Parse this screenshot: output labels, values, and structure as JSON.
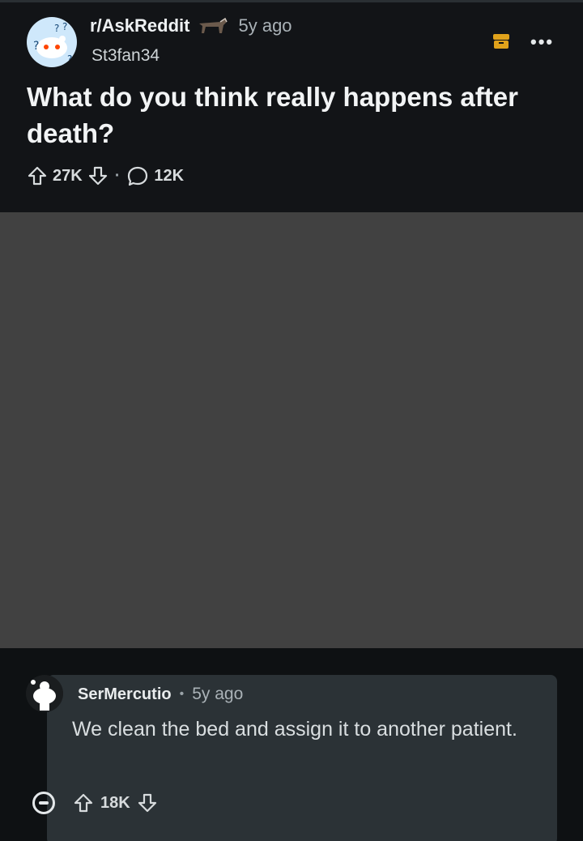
{
  "post": {
    "subreddit": "r/AskReddit",
    "time": "5y ago",
    "author": "St3fan34",
    "title": "What do you think really happens after death?",
    "upvotes": "27K",
    "separator": "·",
    "comments": "12K",
    "more_label": "•••"
  },
  "comment": {
    "username": "SerMercutio",
    "separator": "•",
    "time": "5y ago",
    "body": "We clean the bed and assign it to another patient.",
    "upvotes": "18K"
  },
  "colors": {
    "archive_icon": "#e0a21b",
    "redaction": "#414141",
    "comment_card": "#2b3236"
  }
}
